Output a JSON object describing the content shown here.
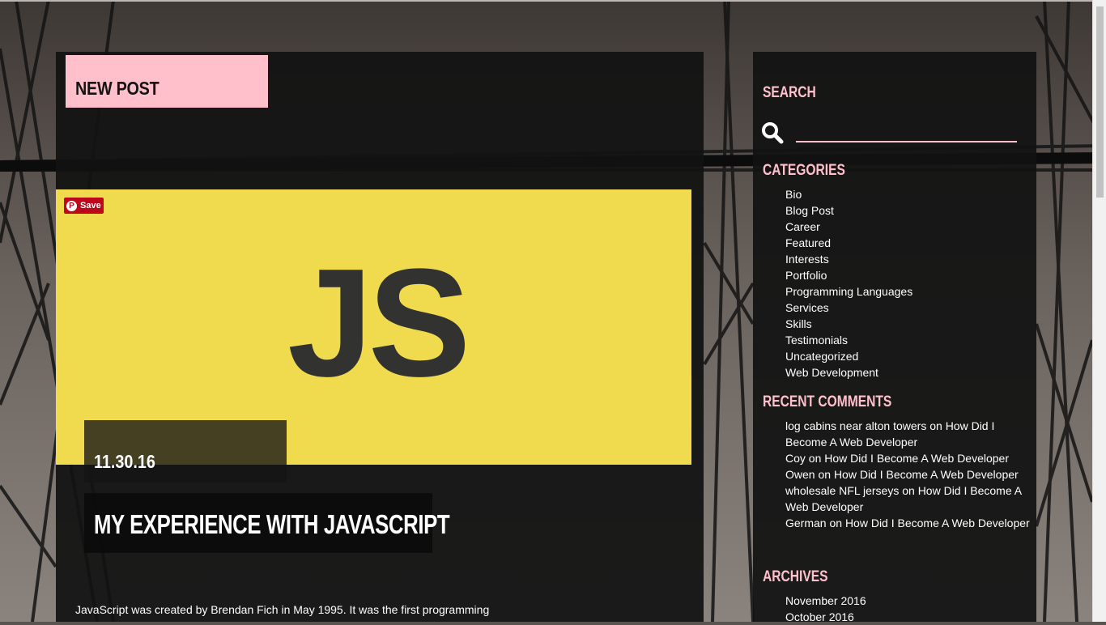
{
  "colors": {
    "accent_pink": "#ffc0cb",
    "js_yellow": "#f0db4f",
    "js_dark": "#323330",
    "panel_bg": "#121212",
    "pinterest_red": "#bd081c"
  },
  "main": {
    "new_post_label": "NEW POST",
    "pinterest_save": "Save",
    "hero_text": "JS",
    "post_date": "11.30.16",
    "post_title": "MY EXPERIENCE WITH JAVASCRIPT",
    "excerpt": "JavaScript was created by Brendan Fich in May 1995. It was the first programming"
  },
  "sidebar": {
    "search_title": "SEARCH",
    "search_value": "",
    "categories_title": "CATEGORIES",
    "categories": [
      "Bio",
      "Blog Post",
      "Career",
      "Featured",
      "Interests",
      "Portfolio",
      "Programming Languages",
      "Services",
      "Skills",
      "Testimonials",
      "Uncategorized",
      "Web Development"
    ],
    "recent_comments_title": "RECENT COMMENTS",
    "recent_comments": [
      {
        "author": "log cabins near alton towers",
        "on": "on",
        "post": "How Did I Become A Web Developer"
      },
      {
        "author": "Coy",
        "on": "on",
        "post": "How Did I Become A Web Developer"
      },
      {
        "author": "Owen",
        "on": "on",
        "post": "How Did I Become A Web Developer"
      },
      {
        "author": "wholesale NFL jerseys",
        "on": "on",
        "post": "How Did I Become A Web Developer"
      },
      {
        "author": "German",
        "on": "on",
        "post": "How Did I Become A Web Developer"
      }
    ],
    "archives_title": "ARCHIVES",
    "archives": [
      "November 2016",
      "October 2016"
    ]
  }
}
